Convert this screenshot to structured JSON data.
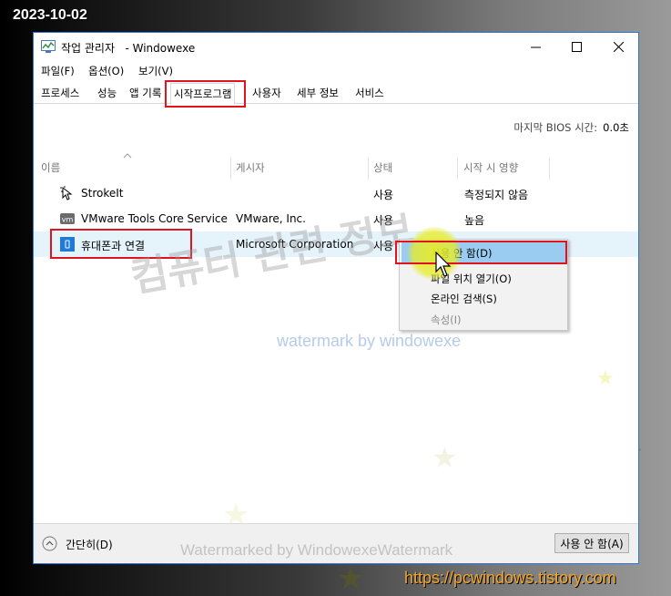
{
  "stamp": {
    "date": "2023-10-02",
    "url": "https://pcwindows.tistory.com"
  },
  "window": {
    "title": "작업 관리자   - Windowexe"
  },
  "menu": [
    "파일(F)",
    "옵션(O)",
    "보기(V)"
  ],
  "tabs": [
    "프로세스",
    "성능",
    "앱 기록",
    "시작프로그램",
    "사용자",
    "세부 정보",
    "서비스"
  ],
  "active_tab": "시작프로그램",
  "bios": {
    "label": "마지막 BIOS 시간:",
    "value": "0.0초"
  },
  "columns": [
    "이름",
    "게시자",
    "상태",
    "시작 시 영향"
  ],
  "rows": [
    {
      "name": "StrokeIt",
      "publisher": "",
      "status": "사용",
      "impact": "측정되지 않음",
      "icon": "strokeit-icon"
    },
    {
      "name": "VMware Tools Core Service",
      "publisher": "VMware, Inc.",
      "status": "사용",
      "impact": "높음",
      "icon": "vmware-icon"
    },
    {
      "name": "휴대폰과 연결",
      "publisher": "Microsoft Corporation",
      "status": "사용",
      "impact": "",
      "icon": "phone-link-icon"
    }
  ],
  "context_menu": [
    {
      "label": "사용 안 함(D)",
      "enabled": true
    },
    {
      "label": "파일 위치 열기(O)",
      "enabled": true
    },
    {
      "label": "온라인 검색(S)",
      "enabled": true
    },
    {
      "label": "속성(I)",
      "enabled": false
    }
  ],
  "footer": {
    "fewer_details": "간단히(D)",
    "disable_button": "사용 안 함(A)"
  },
  "watermarks": {
    "big": "컴퓨터 관련 정보",
    "small": "watermark by windowexe",
    "bottom": "Watermarked by WindowexeWatermark"
  },
  "colors": {
    "highlight_box": "#e0141e",
    "selected_row": "#e5f3fb",
    "menu_highlight": "#99ccf0",
    "url": "#f5a623"
  }
}
